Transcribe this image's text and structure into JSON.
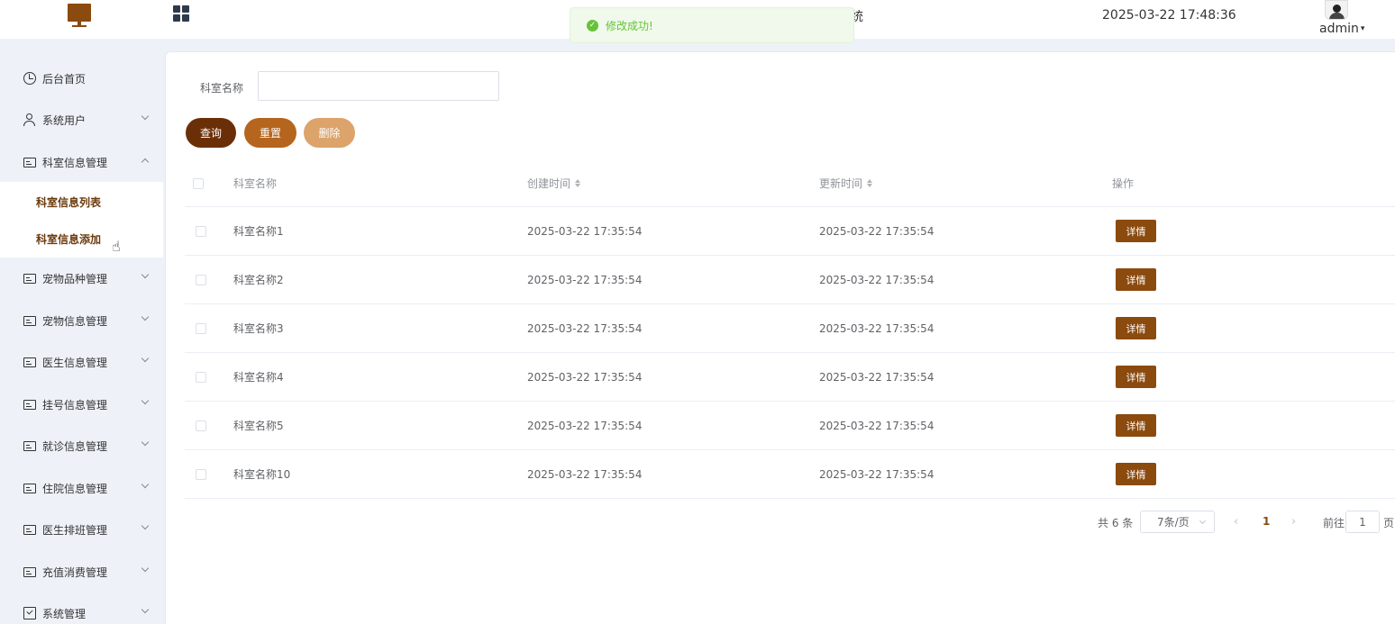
{
  "header": {
    "title_tail": "统",
    "datetime": "2025-03-22 17:48:36",
    "user": "admin"
  },
  "toast": {
    "message": "修改成功!"
  },
  "sidebar": {
    "items": [
      {
        "label": "后台首页",
        "icon": "clock-icon"
      },
      {
        "label": "系统用户",
        "icon": "user-icon"
      },
      {
        "label": "科室信息管理",
        "icon": "card-icon"
      },
      {
        "label": "宠物品种管理",
        "icon": "card-icon"
      },
      {
        "label": "宠物信息管理",
        "icon": "card-icon"
      },
      {
        "label": "医生信息管理",
        "icon": "card-icon"
      },
      {
        "label": "挂号信息管理",
        "icon": "card-icon"
      },
      {
        "label": "就诊信息管理",
        "icon": "card-icon"
      },
      {
        "label": "住院信息管理",
        "icon": "card-icon"
      },
      {
        "label": "医生排班管理",
        "icon": "card-icon"
      },
      {
        "label": "充值消费管理",
        "icon": "card-icon"
      },
      {
        "label": "系统管理",
        "icon": "checkbox-icon"
      }
    ],
    "submenu": [
      {
        "label": "科室信息列表"
      },
      {
        "label": "科室信息添加"
      }
    ]
  },
  "search": {
    "label": "科室名称",
    "value": "",
    "placeholder": ""
  },
  "buttons": {
    "query": "查询",
    "reset": "重置",
    "delete": "删除"
  },
  "table": {
    "columns": {
      "name": "科室名称",
      "created": "创建时间",
      "updated": "更新时间",
      "op": "操作"
    },
    "detail_label": "详情",
    "rows": [
      {
        "name": "科室名称1",
        "created": "2025-03-22 17:35:54",
        "updated": "2025-03-22 17:35:54"
      },
      {
        "name": "科室名称2",
        "created": "2025-03-22 17:35:54",
        "updated": "2025-03-22 17:35:54"
      },
      {
        "name": "科室名称3",
        "created": "2025-03-22 17:35:54",
        "updated": "2025-03-22 17:35:54"
      },
      {
        "name": "科室名称4",
        "created": "2025-03-22 17:35:54",
        "updated": "2025-03-22 17:35:54"
      },
      {
        "name": "科室名称5",
        "created": "2025-03-22 17:35:54",
        "updated": "2025-03-22 17:35:54"
      },
      {
        "name": "科室名称10",
        "created": "2025-03-22 17:35:54",
        "updated": "2025-03-22 17:35:54"
      }
    ]
  },
  "pagination": {
    "total": "共 6 条",
    "page_size": "7条/页",
    "current": "1",
    "goto_label": "前往",
    "goto_value": "1",
    "page_suffix": "页"
  },
  "colors": {
    "brand": "#8b4a0e",
    "query_button": "#6b2f08",
    "reset_button": "#b5651d",
    "delete_button": "#dca36a",
    "success": "#67c23a"
  }
}
